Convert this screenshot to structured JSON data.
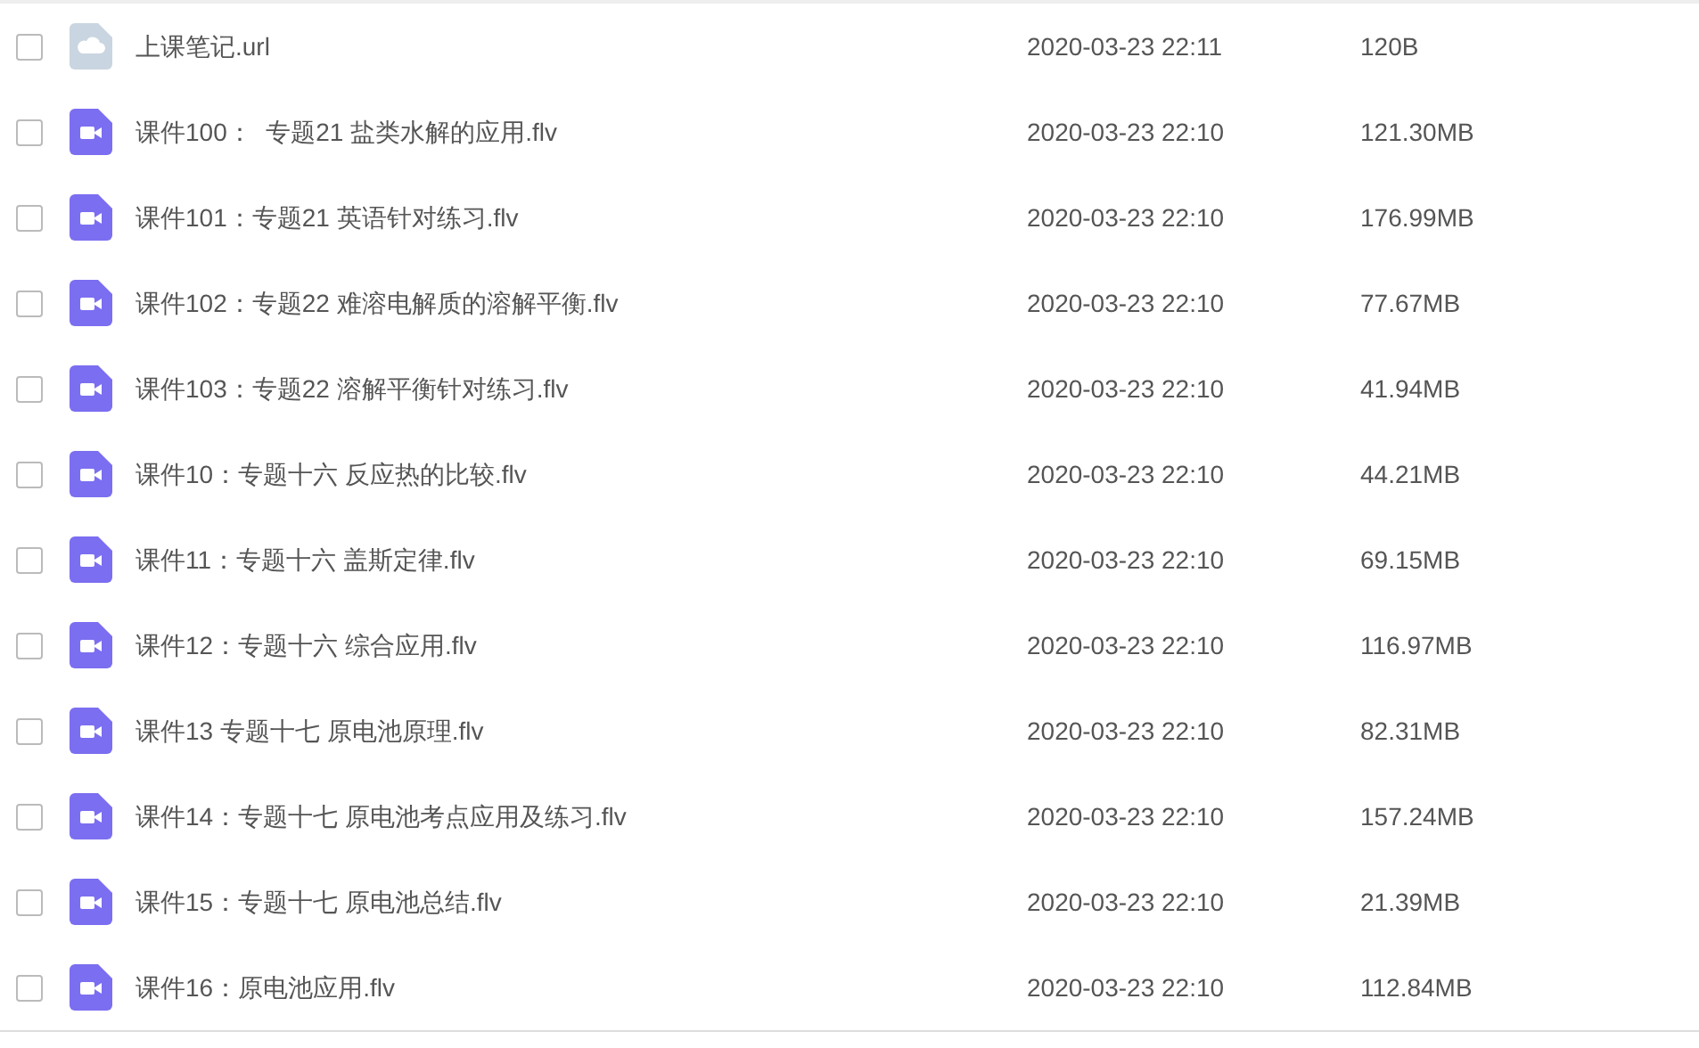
{
  "files": [
    {
      "kind": "link",
      "checked": false,
      "name": "上课笔记.url",
      "modified": "2020-03-23 22:11",
      "size": "120B"
    },
    {
      "kind": "video",
      "checked": false,
      "name": "课件100：  专题21 盐类水解的应用.flv",
      "modified": "2020-03-23 22:10",
      "size": "121.30MB"
    },
    {
      "kind": "video",
      "checked": false,
      "name": "课件101：专题21 英语针对练习.flv",
      "modified": "2020-03-23 22:10",
      "size": "176.99MB"
    },
    {
      "kind": "video",
      "checked": false,
      "name": "课件102：专题22 难溶电解质的溶解平衡.flv",
      "modified": "2020-03-23 22:10",
      "size": "77.67MB"
    },
    {
      "kind": "video",
      "checked": false,
      "name": "课件103：专题22 溶解平衡针对练习.flv",
      "modified": "2020-03-23 22:10",
      "size": "41.94MB"
    },
    {
      "kind": "video",
      "checked": false,
      "name": "课件10：专题十六 反应热的比较.flv",
      "modified": "2020-03-23 22:10",
      "size": "44.21MB"
    },
    {
      "kind": "video",
      "checked": false,
      "name": "课件11：专题十六 盖斯定律.flv",
      "modified": "2020-03-23 22:10",
      "size": "69.15MB"
    },
    {
      "kind": "video",
      "checked": false,
      "name": "课件12：专题十六 综合应用.flv",
      "modified": "2020-03-23 22:10",
      "size": "116.97MB"
    },
    {
      "kind": "video",
      "checked": false,
      "name": "课件13 专题十七 原电池原理.flv",
      "modified": "2020-03-23 22:10",
      "size": "82.31MB"
    },
    {
      "kind": "video",
      "checked": false,
      "name": "课件14：专题十七 原电池考点应用及练习.flv",
      "modified": "2020-03-23 22:10",
      "size": "157.24MB"
    },
    {
      "kind": "video",
      "checked": false,
      "name": "课件15：专题十七 原电池总结.flv",
      "modified": "2020-03-23 22:10",
      "size": "21.39MB"
    },
    {
      "kind": "video",
      "checked": false,
      "name": "课件16：原电池应用.flv",
      "modified": "2020-03-23 22:10",
      "size": "112.84MB"
    }
  ]
}
